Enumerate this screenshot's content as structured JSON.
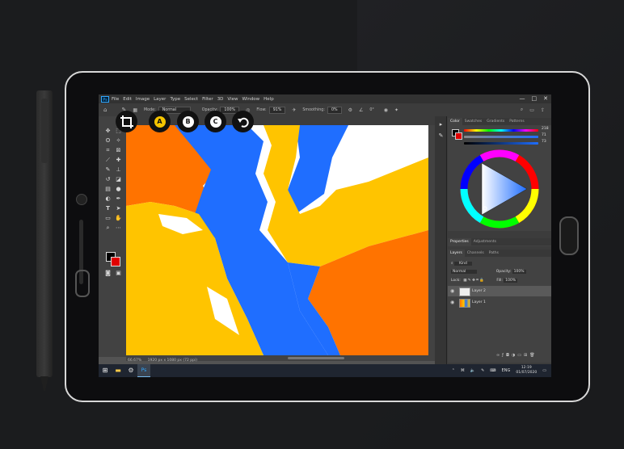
{
  "menu": {
    "app_icon": "Ps",
    "items": [
      "File",
      "Edit",
      "Image",
      "Layer",
      "Type",
      "Select",
      "Filter",
      "3D",
      "View",
      "Window",
      "Help"
    ],
    "window_controls": [
      "—",
      "□",
      "✕"
    ]
  },
  "options_bar": {
    "mode_label": "Mode:",
    "mode_value": "Normal",
    "opacity_label": "Opacity:",
    "opacity_value": "100%",
    "flow_label": "Flow:",
    "flow_value": "91%",
    "smoothing_label": "Smoothing:",
    "smoothing_value": "0%",
    "angle_value": "0°"
  },
  "document": {
    "zoom_status": "66.67%",
    "size_status": "1920 px x 1080 px (72 ppi)"
  },
  "quick_buttons": [
    {
      "name": "crop-icon",
      "label": "",
      "accent": "#ffffff"
    },
    {
      "name": "a-button",
      "label": "A",
      "accent": "#f5c400"
    },
    {
      "name": "b-button",
      "label": "B",
      "accent": "#ffffff"
    },
    {
      "name": "c-button",
      "label": "C",
      "accent": "#ffffff"
    },
    {
      "name": "undo-icon",
      "label": "",
      "accent": "#ffffff"
    }
  ],
  "color_panel": {
    "tabs": [
      "Color",
      "Swatches",
      "Gradients",
      "Patterns"
    ],
    "active_tab": "Color",
    "h_value": "218",
    "s_value": "71",
    "b_value": "73"
  },
  "properties_panel": {
    "tabs": [
      "Properties",
      "Adjustments"
    ]
  },
  "layers_panel": {
    "tabs": [
      "Layers",
      "Channels",
      "Paths"
    ],
    "kind_label": "Kind",
    "blend_mode": "Normal",
    "opacity_label": "Opacity:",
    "opacity_value": "100%",
    "lock_label": "Lock:",
    "fill_label": "Fill:",
    "fill_value": "100%",
    "layers": [
      {
        "name": "Layer 2",
        "selected": true
      },
      {
        "name": "Layer 1",
        "selected": false
      }
    ]
  },
  "taskbar": {
    "items": [
      "windows-icon",
      "folder-icon",
      "gear-icon",
      "photoshop-icon"
    ],
    "language": "ENG",
    "time": "12:19",
    "date": "01/07/2020"
  },
  "colors": {
    "orange": "#ff7300",
    "blue": "#1f6eff",
    "yellow": "#ffc400",
    "foreground": "#000000",
    "background": "#e00000"
  }
}
